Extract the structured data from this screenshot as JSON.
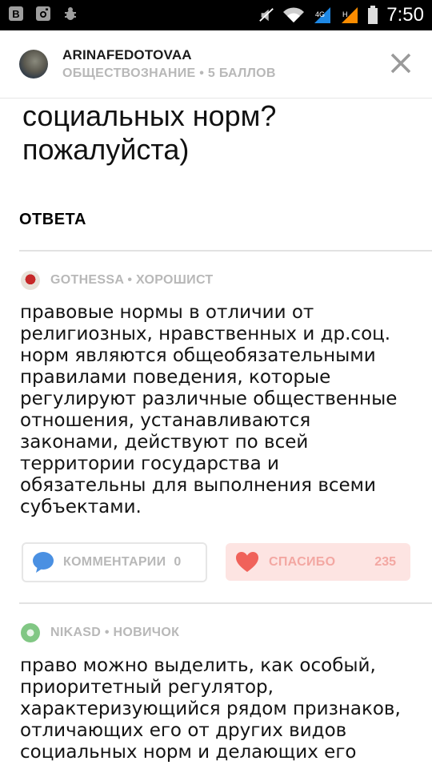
{
  "status_bar": {
    "time": "7:50",
    "left_icons": [
      "vk-icon",
      "instagram-icon",
      "bug-icon"
    ],
    "right_icons": [
      "mute-icon",
      "wifi-icon",
      "signal-icon",
      "signal-icon-2",
      "battery-icon"
    ]
  },
  "header": {
    "username": "ARINAFEDOTOVAA",
    "meta": "ОБЩЕСТВОЗНАНИЕ • 5 БАЛЛОВ"
  },
  "question": {
    "lines": [
      "социальных норм?",
      "пожалуйста)"
    ]
  },
  "answers_title": "ОТВЕТА",
  "answers": [
    {
      "author": "GOTHESSA • ХОРОШИСТ",
      "lines": [
        "правовые нормы в отличии от",
        "религиозных, нравственных и др.соц.",
        "норм являются общеобязательными",
        "правилами поведения, которые",
        "регулируют различные общественные",
        "отношения, устанавливаются",
        "законами, действуют по всей",
        "территории государства и",
        "обязательны для выполнения всеми",
        "субъектами."
      ],
      "comments_label": "КОММЕНТАРИИ",
      "comments_count": "0",
      "thanks_label": "СПАСИБО",
      "thanks_count": "235"
    },
    {
      "author": "NIKASD • НОВИЧОК",
      "lines": [
        "право можно выделить, как особый,",
        "приоритетный регулятор,",
        "характеризующийся рядом признаков,",
        "отличающих его от других видов",
        "социальных норм и делающих его"
      ]
    }
  ],
  "colors": {
    "accent_blue": "#4a90e2",
    "heart_red": "#f0625a",
    "muted_text": "#b8b8b8",
    "thanks_bg": "#fde4e2"
  }
}
